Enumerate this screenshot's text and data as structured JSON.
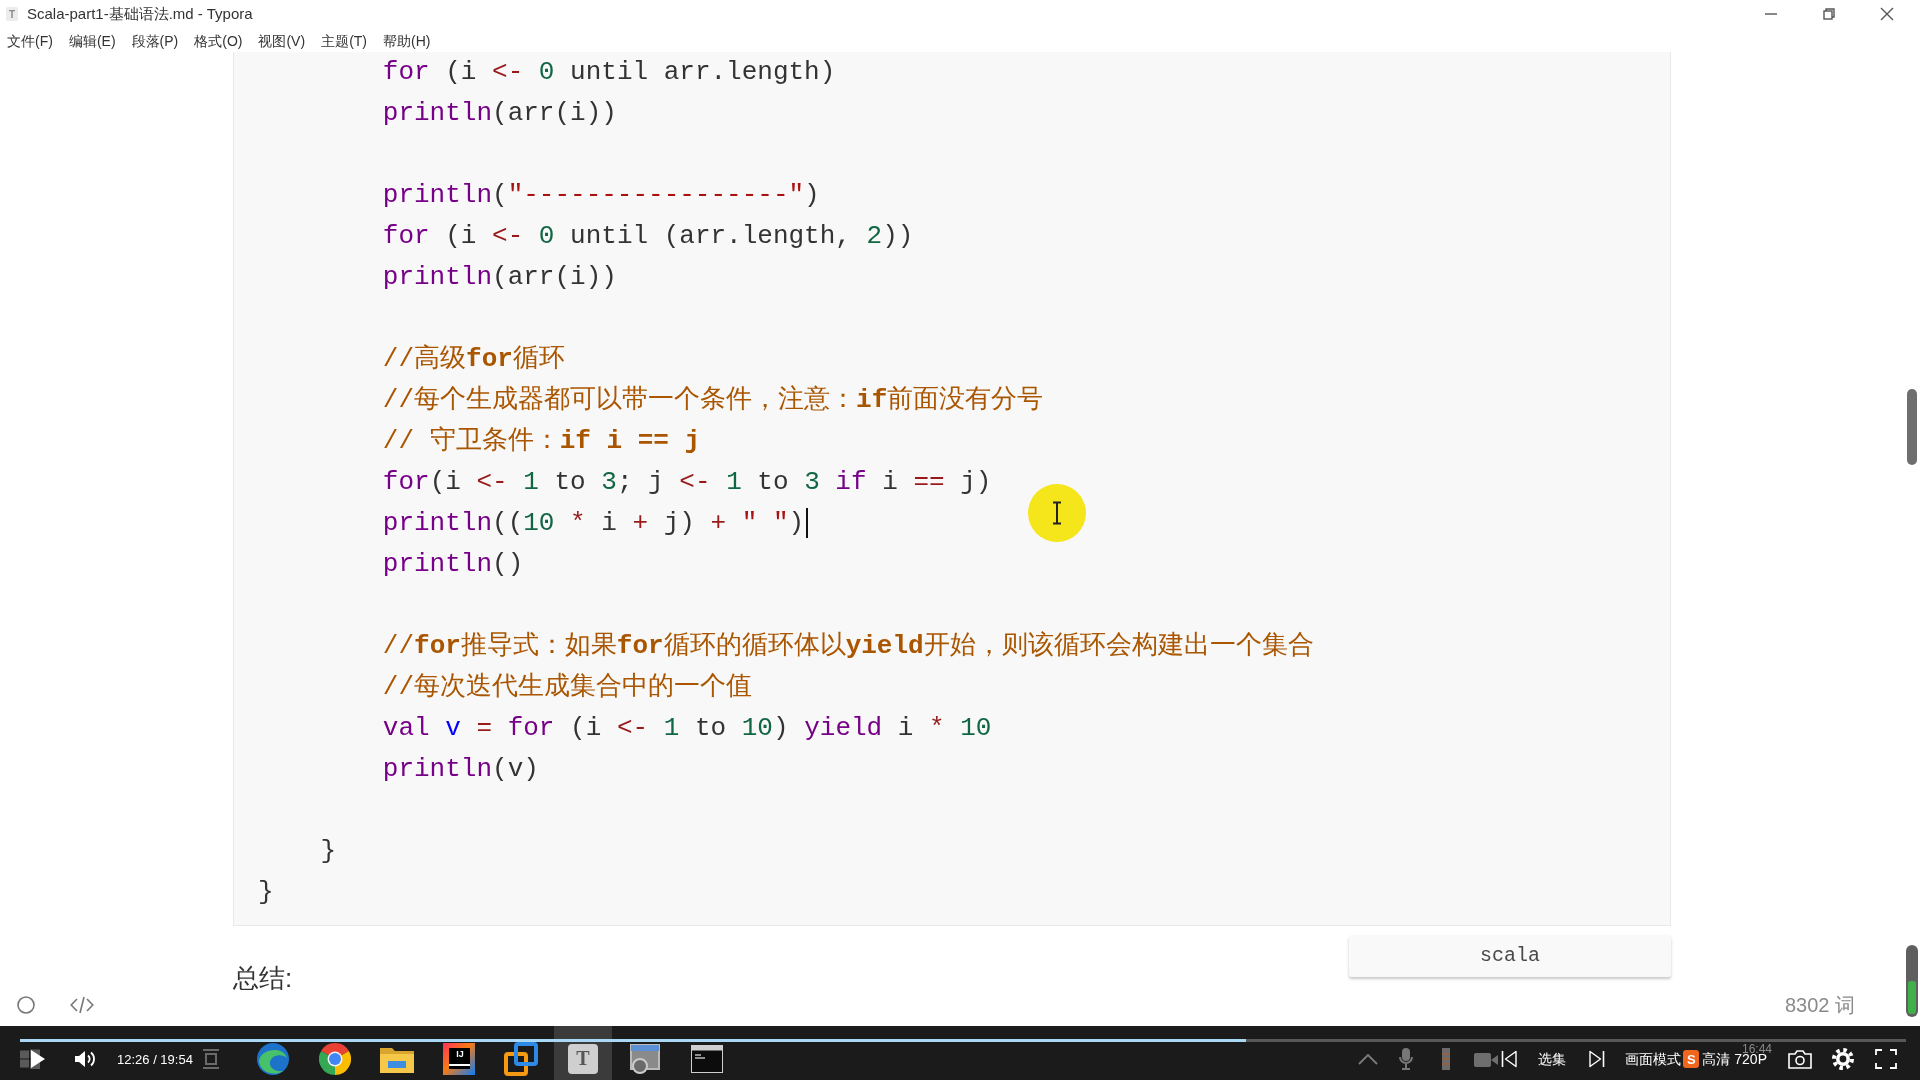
{
  "window": {
    "icon_label": "T",
    "title": "Scala-part1-基础语法.md - Typora"
  },
  "menu": [
    "文件(F)",
    "编辑(E)",
    "段落(P)",
    "格式(O)",
    "视图(V)",
    "主题(T)",
    "帮助(H)"
  ],
  "code_block": {
    "lines": [
      {
        "kind": "group",
        "children": [
          {
            "kind": "group",
            "children": [
              {
                "kind": "code",
                "tokens": [
                  {
                    "kind": "keyword",
                    "text": "for"
                  },
                  {
                    "kind": "plain",
                    "text": " (i "
                  },
                  {
                    "kind": "operator",
                    "text": "<- "
                  },
                  {
                    "kind": "number",
                    "text": "0"
                  },
                  {
                    "kind": "plain",
                    "text": " until arr.length)"
                  }
                ]
              },
              {
                "kind": "code",
                "tokens": [
                  {
                    "kind": "keyword",
                    "text": "println"
                  },
                  {
                    "kind": "plain",
                    "text": "(arr(i))"
                  }
                ]
              },
              {
                "kind": "blank"
              },
              {
                "kind": "code",
                "tokens": [
                  {
                    "kind": "keyword",
                    "text": "println"
                  },
                  {
                    "kind": "plain",
                    "text": "("
                  },
                  {
                    "kind": "string",
                    "text": "\"-----------------\""
                  },
                  {
                    "kind": "plain",
                    "text": ")"
                  }
                ]
              },
              {
                "kind": "code",
                "tokens": [
                  {
                    "kind": "keyword",
                    "text": "for"
                  },
                  {
                    "kind": "plain",
                    "text": " (i "
                  },
                  {
                    "kind": "operator",
                    "text": "<- "
                  },
                  {
                    "kind": "number",
                    "text": "0"
                  },
                  {
                    "kind": "plain",
                    "text": " until (arr.length, "
                  },
                  {
                    "kind": "number",
                    "text": "2"
                  },
                  {
                    "kind": "plain",
                    "text": "))"
                  }
                ]
              },
              {
                "kind": "code",
                "tokens": [
                  {
                    "kind": "keyword",
                    "text": "println"
                  },
                  {
                    "kind": "plain",
                    "text": "(arr(i))"
                  }
                ]
              },
              {
                "kind": "blank"
              },
              {
                "kind": "code",
                "tokens": [
                  {
                    "kind": "comment",
                    "text": "//高级**for**循环"
                  }
                ]
              },
              {
                "kind": "code",
                "tokens": [
                  {
                    "kind": "comment",
                    "text": "//每个生成器都可以带一个条件，注意：**if**前面没有分号"
                  }
                ]
              },
              {
                "kind": "code",
                "tokens": [
                  {
                    "kind": "comment",
                    "text": "// 守卫条件：**if i == j**"
                  }
                ]
              },
              {
                "kind": "code",
                "tokens": [
                  {
                    "kind": "keyword",
                    "text": "for"
                  },
                  {
                    "kind": "plain",
                    "text": "(i "
                  },
                  {
                    "kind": "operator",
                    "text": "<- "
                  },
                  {
                    "kind": "number",
                    "text": "1"
                  },
                  {
                    "kind": "plain",
                    "text": " to "
                  },
                  {
                    "kind": "number",
                    "text": "3"
                  },
                  {
                    "kind": "plain",
                    "text": "; j "
                  },
                  {
                    "kind": "operator",
                    "text": "<- "
                  },
                  {
                    "kind": "number",
                    "text": "1"
                  },
                  {
                    "kind": "plain",
                    "text": " to "
                  },
                  {
                    "kind": "number",
                    "text": "3"
                  },
                  {
                    "kind": "keyword",
                    "text": " if"
                  },
                  {
                    "kind": "plain",
                    "text": " i "
                  },
                  {
                    "kind": "operator",
                    "text": "=="
                  },
                  {
                    "kind": "plain",
                    "text": " j)"
                  }
                ]
              },
              {
                "kind": "code",
                "caret": true,
                "tokens": [
                  {
                    "kind": "keyword",
                    "text": "println"
                  },
                  {
                    "kind": "plain",
                    "text": "(("
                  },
                  {
                    "kind": "number",
                    "text": "10"
                  },
                  {
                    "kind": "operator",
                    "text": " * "
                  },
                  {
                    "kind": "plain",
                    "text": "i"
                  },
                  {
                    "kind": "operator",
                    "text": " + "
                  },
                  {
                    "kind": "plain",
                    "text": "j) "
                  },
                  {
                    "kind": "operator",
                    "text": "+ "
                  },
                  {
                    "kind": "string",
                    "text": "\" \""
                  },
                  {
                    "kind": "plain",
                    "text": ")"
                  }
                ]
              },
              {
                "kind": "code",
                "tokens": [
                  {
                    "kind": "keyword",
                    "text": "println"
                  },
                  {
                    "kind": "plain",
                    "text": "()"
                  }
                ]
              },
              {
                "kind": "blank"
              },
              {
                "kind": "code",
                "tokens": [
                  {
                    "kind": "comment",
                    "text": "//**for**推导式：如果**for**循环的循环体以**yield**开始，则该循环会构建出一个集合"
                  }
                ]
              },
              {
                "kind": "code",
                "tokens": [
                  {
                    "kind": "comment",
                    "text": "//每次迭代生成集合中的一个值"
                  }
                ]
              },
              {
                "kind": "code",
                "tokens": [
                  {
                    "kind": "keyword",
                    "text": "val "
                  },
                  {
                    "kind": "def",
                    "text": "v"
                  },
                  {
                    "kind": "operator",
                    "text": " = "
                  },
                  {
                    "kind": "keyword",
                    "text": "for"
                  },
                  {
                    "kind": "plain",
                    "text": " (i "
                  },
                  {
                    "kind": "operator",
                    "text": "<- "
                  },
                  {
                    "kind": "number",
                    "text": "1"
                  },
                  {
                    "kind": "plain",
                    "text": " to "
                  },
                  {
                    "kind": "number",
                    "text": "10"
                  },
                  {
                    "kind": "plain",
                    "text": ") "
                  },
                  {
                    "kind": "keyword",
                    "text": "yield"
                  },
                  {
                    "kind": "plain",
                    "text": " i "
                  },
                  {
                    "kind": "operator",
                    "text": "* "
                  },
                  {
                    "kind": "number",
                    "text": "10"
                  }
                ]
              },
              {
                "kind": "code",
                "tokens": [
                  {
                    "kind": "keyword",
                    "text": "println"
                  },
                  {
                    "kind": "plain",
                    "text": "(v)"
                  }
                ]
              },
              {
                "kind": "blank"
              }
            ]
          },
          {
            "kind": "code",
            "tokens": [
              {
                "kind": "plain",
                "text": "}"
              }
            ]
          }
        ]
      },
      {
        "kind": "code",
        "tokens": [
          {
            "kind": "plain",
            "text": "}"
          }
        ]
      }
    ],
    "language": "scala"
  },
  "paragraph": "总结:",
  "status_bar": {
    "word_count": "8302 词"
  },
  "player": {
    "elapsed": "12:26 / 19:54",
    "progress": {
      "level": 0.65
    },
    "episodes": "选集",
    "picture_mode": "画面模式",
    "quality": "高清 720P"
  },
  "taskbar": {
    "apps": [
      {
        "kind": "swirl",
        "selected": false
      },
      {
        "kind": "segmented-circle",
        "selected": false
      },
      {
        "kind": "folder",
        "selected": false
      },
      {
        "kind": "gradient-letters",
        "label": "IJ",
        "selected": false
      },
      {
        "kind": "squares",
        "selected": false
      },
      {
        "kind": "letter-tile",
        "label": "T",
        "selected": true
      },
      {
        "kind": "window",
        "selected": false
      },
      {
        "kind": "terminal",
        "selected": false
      }
    ],
    "ime_label": "S",
    "clock": "16:44"
  }
}
